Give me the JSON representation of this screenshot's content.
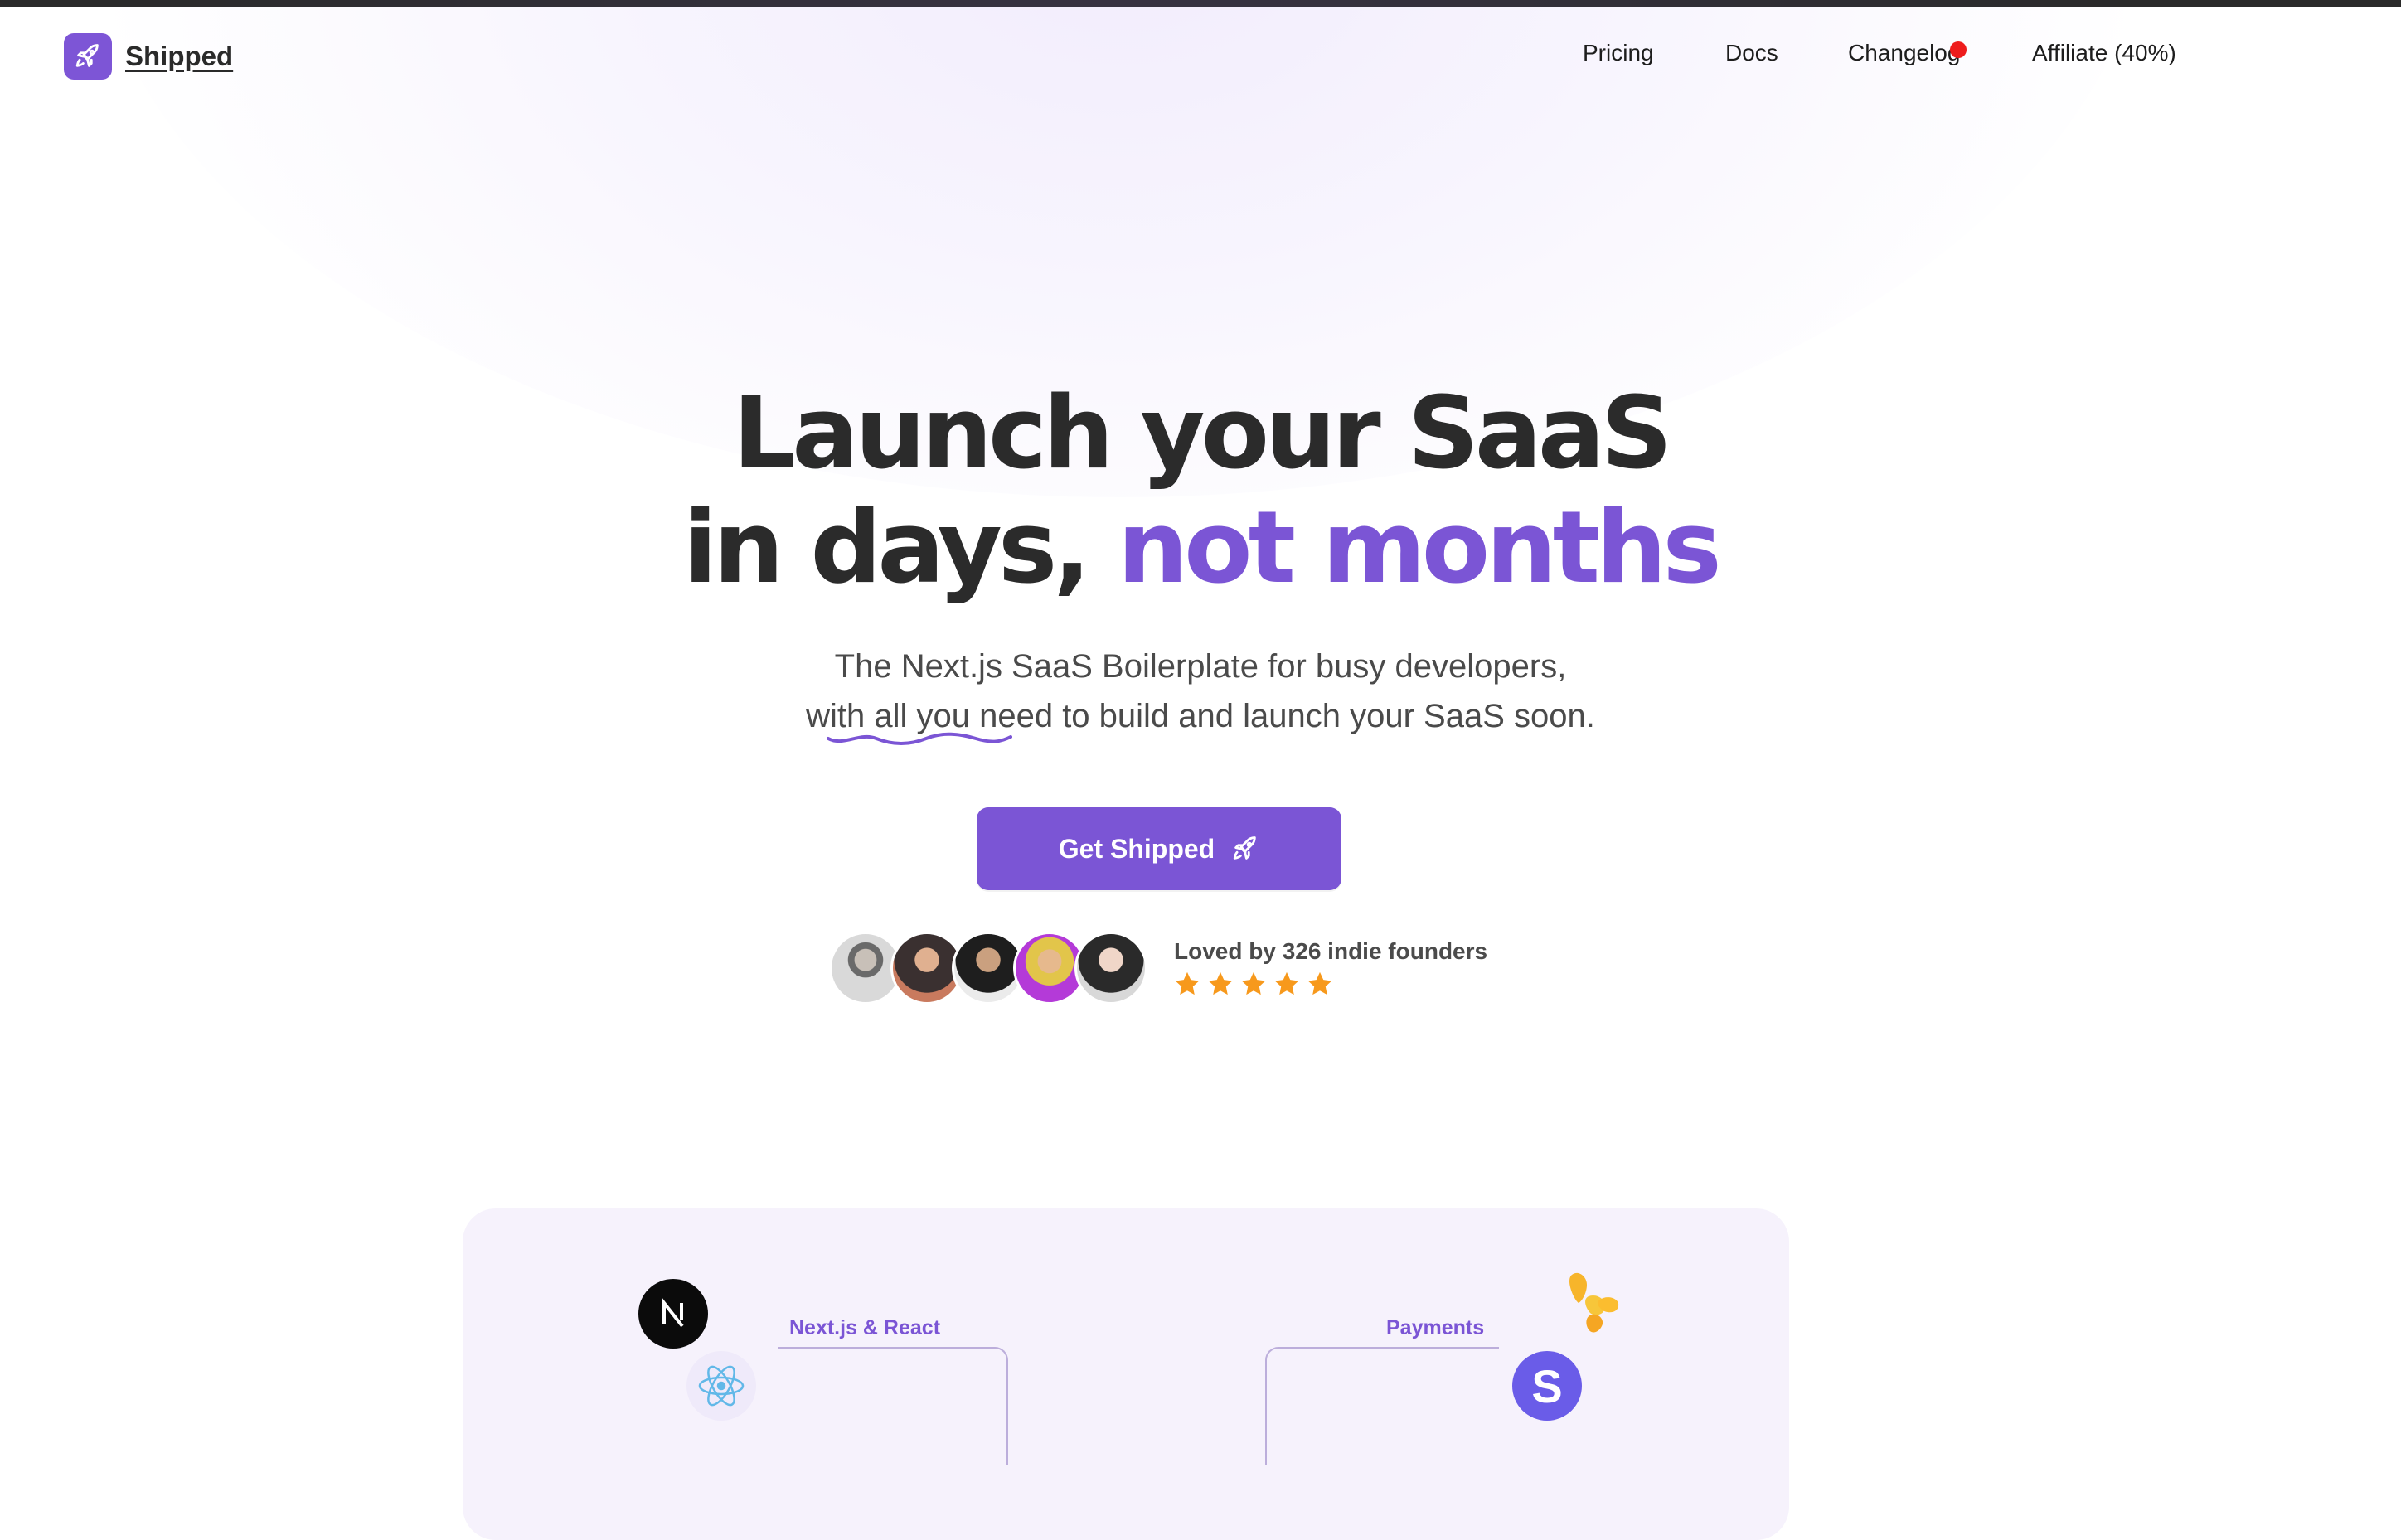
{
  "brand": {
    "name": "Shipped"
  },
  "nav": {
    "items": [
      {
        "label": "Pricing"
      },
      {
        "label": "Docs"
      },
      {
        "label": "Changelog"
      },
      {
        "label": "Affiliate (40%)"
      }
    ]
  },
  "hero": {
    "headline_line1": "Launch your SaaS",
    "headline_line2_part1": "in days,",
    "headline_line2_accent": "not months",
    "subtitle_line1": "The Next.js SaaS Boilerplate for busy developers,",
    "subtitle_line2": "with all you need to build and launch your SaaS soon.",
    "cta_label": "Get Shipped"
  },
  "social_proof": {
    "text": "Loved by 326 indie founders",
    "rating": 5
  },
  "features": {
    "items": [
      {
        "label": "Next.js & React"
      },
      {
        "label": "Payments"
      }
    ]
  },
  "colors": {
    "accent": "#7b55d5",
    "text": "#2b2b2b",
    "star": "#f7991c",
    "notification": "#ee1c1c"
  }
}
